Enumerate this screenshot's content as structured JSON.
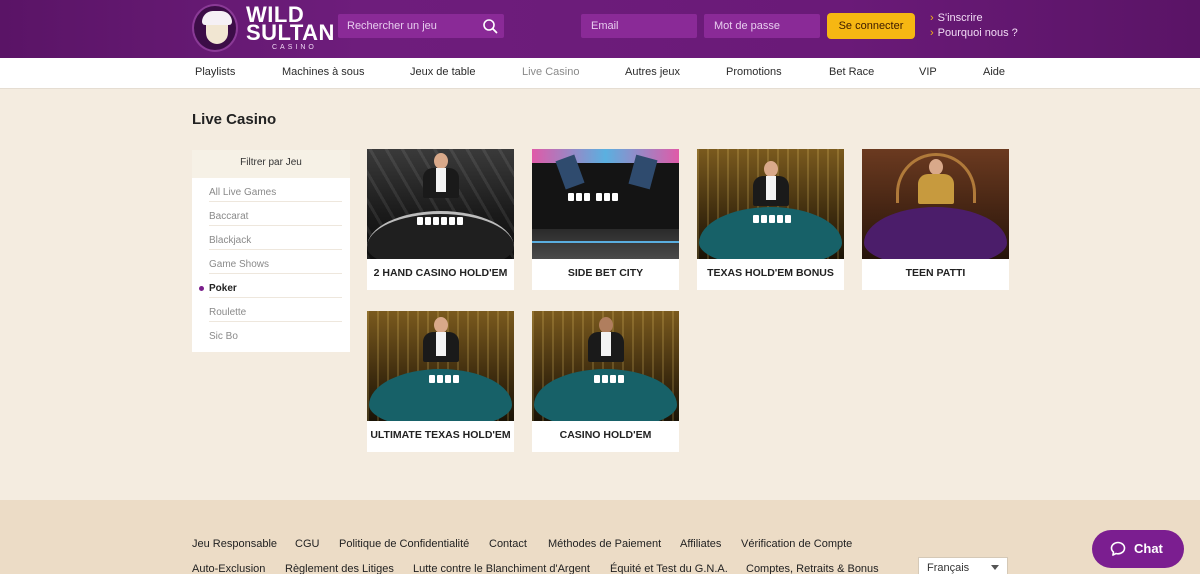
{
  "header": {
    "logo": {
      "line1": "WILD",
      "line2": "SULTAN",
      "line3": "CASINO"
    },
    "search": {
      "placeholder": "Rechercher un jeu"
    },
    "email": {
      "placeholder": "Email"
    },
    "password": {
      "placeholder": "Mot de passe"
    },
    "login_label": "Se connecter",
    "links": [
      {
        "label": "S'inscrire"
      },
      {
        "label": "Pourquoi nous ?"
      }
    ]
  },
  "nav": {
    "items": [
      {
        "label": "Playlists"
      },
      {
        "label": "Machines à sous"
      },
      {
        "label": "Jeux de table"
      },
      {
        "label": "Live Casino",
        "active": true
      },
      {
        "label": "Autres jeux"
      },
      {
        "label": "Promotions"
      },
      {
        "label": "Bet Race"
      },
      {
        "label": "VIP"
      },
      {
        "label": "Aide"
      }
    ]
  },
  "main": {
    "title": "Live Casino",
    "filter": {
      "heading": "Filtrer par Jeu",
      "items": [
        {
          "label": "All Live Games"
        },
        {
          "label": "Baccarat"
        },
        {
          "label": "Blackjack"
        },
        {
          "label": "Game Shows"
        },
        {
          "label": "Poker",
          "active": true
        },
        {
          "label": "Roulette"
        },
        {
          "label": "Sic Bo"
        }
      ]
    },
    "games": [
      {
        "name": "2 HAND CASINO HOLD'EM"
      },
      {
        "name": "SIDE BET CITY"
      },
      {
        "name": "TEXAS HOLD'EM BONUS"
      },
      {
        "name": "TEEN PATTI"
      },
      {
        "name": "ULTIMATE TEXAS HOLD'EM"
      },
      {
        "name": "CASINO HOLD'EM"
      }
    ]
  },
  "footer": {
    "row1": [
      {
        "label": "Jeu Responsable"
      },
      {
        "label": "CGU"
      },
      {
        "label": "Politique de Confidentialité"
      },
      {
        "label": "Contact"
      },
      {
        "label": "Méthodes de Paiement"
      },
      {
        "label": "Affiliates"
      },
      {
        "label": "Vérification de Compte"
      }
    ],
    "row2": [
      {
        "label": "Auto-Exclusion"
      },
      {
        "label": "Règlement des Litiges"
      },
      {
        "label": "Lutte contre le Blanchiment d'Argent"
      },
      {
        "label": "Équité et Test du G.N.A."
      },
      {
        "label": "Comptes, Retraits & Bonus"
      }
    ],
    "language": "Français",
    "chat_label": "Chat"
  },
  "colors": {
    "header_bg": "#6a1a78",
    "accent_yellow": "#f6b712",
    "chat_purple": "#7b1e90",
    "page_bg": "#f4ece0"
  }
}
